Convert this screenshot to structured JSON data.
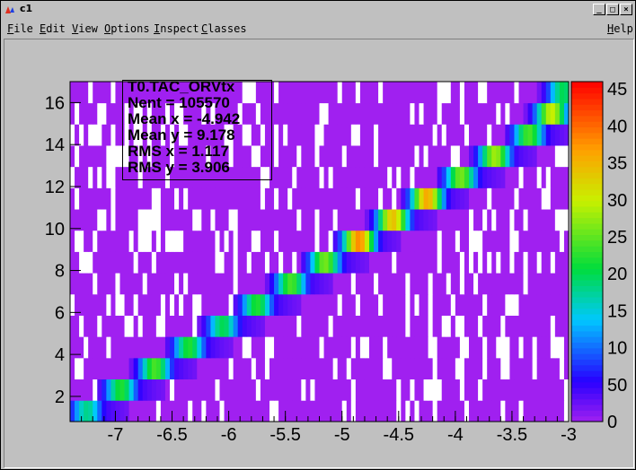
{
  "window": {
    "title": "c1",
    "buttons": {
      "minimize": "_",
      "maximize": "□",
      "close": "×"
    }
  },
  "menu": {
    "items": [
      {
        "label": "File",
        "underline": "F",
        "rest": "ile"
      },
      {
        "label": "Edit",
        "underline": "E",
        "rest": "dit"
      },
      {
        "label": "View",
        "underline": "V",
        "rest": "iew"
      },
      {
        "label": "Options",
        "underline": "O",
        "rest": "ptions"
      },
      {
        "label": "Inspect",
        "underline": "I",
        "rest": "nspect"
      },
      {
        "label": "Classes",
        "underline": "C",
        "rest": "lasses"
      },
      {
        "label": "Help",
        "underline": "H",
        "rest": "elp"
      }
    ]
  },
  "stats": {
    "name": "T0.TAC_ORVtx",
    "entries_label": "Nent = ",
    "entries": "105570",
    "mean_x_label": "Mean x = ",
    "mean_x": "-4.942",
    "mean_y_label": "Mean y = ",
    "mean_y": "9.178",
    "rms_x_label": "RMS x  = ",
    "rms_x": "1.117",
    "rms_y_label": "RMS y  = ",
    "rms_y": "3.906"
  },
  "chart_data": {
    "type": "heatmap",
    "title": "T0.TAC_ORVtx",
    "xlabel": "",
    "ylabel": "",
    "xlim": [
      -7.4,
      -3.0
    ],
    "ylim": [
      0.8,
      17.0
    ],
    "zlim": [
      0,
      46
    ],
    "x_ticks": [
      -7,
      -6.5,
      -6,
      -5.5,
      -5,
      -4.5,
      -4,
      -3.5,
      -3
    ],
    "x_tick_labels": [
      "-7",
      "-6.5",
      "-6",
      "-5.5",
      "-5",
      "-4.5",
      "-4",
      "-3.5",
      "-3"
    ],
    "y_ticks": [
      2,
      4,
      6,
      8,
      10,
      12,
      14,
      16
    ],
    "y_tick_labels": [
      "2",
      "4",
      "6",
      "8",
      "10",
      "12",
      "14",
      "16"
    ],
    "z_ticks": [
      0,
      5,
      10,
      15,
      20,
      25,
      30,
      35,
      40,
      45
    ],
    "z_tick_labels": [
      "0",
      "50",
      "10",
      "15",
      "20",
      "25",
      "30",
      "35",
      "40",
      "45"
    ],
    "ridge": [
      {
        "y": 1,
        "x": -7.25,
        "max": 18
      },
      {
        "y": 2,
        "x": -6.95,
        "max": 22
      },
      {
        "y": 3,
        "x": -6.65,
        "max": 24
      },
      {
        "y": 4,
        "x": -6.35,
        "max": 22
      },
      {
        "y": 5,
        "x": -6.05,
        "max": 20
      },
      {
        "y": 6,
        "x": -5.75,
        "max": 22
      },
      {
        "y": 7,
        "x": -5.45,
        "max": 24
      },
      {
        "y": 8,
        "x": -5.15,
        "max": 26
      },
      {
        "y": 9,
        "x": -4.85,
        "max": 38
      },
      {
        "y": 10,
        "x": -4.55,
        "max": 34
      },
      {
        "y": 11,
        "x": -4.25,
        "max": 36
      },
      {
        "y": 12,
        "x": -3.95,
        "max": 26
      },
      {
        "y": 13,
        "x": -3.65,
        "max": 28
      },
      {
        "y": 14,
        "x": -3.35,
        "max": 24
      },
      {
        "y": 15,
        "x": -3.15,
        "max": 30
      },
      {
        "y": 16,
        "x": -3.05,
        "max": 20
      }
    ]
  }
}
